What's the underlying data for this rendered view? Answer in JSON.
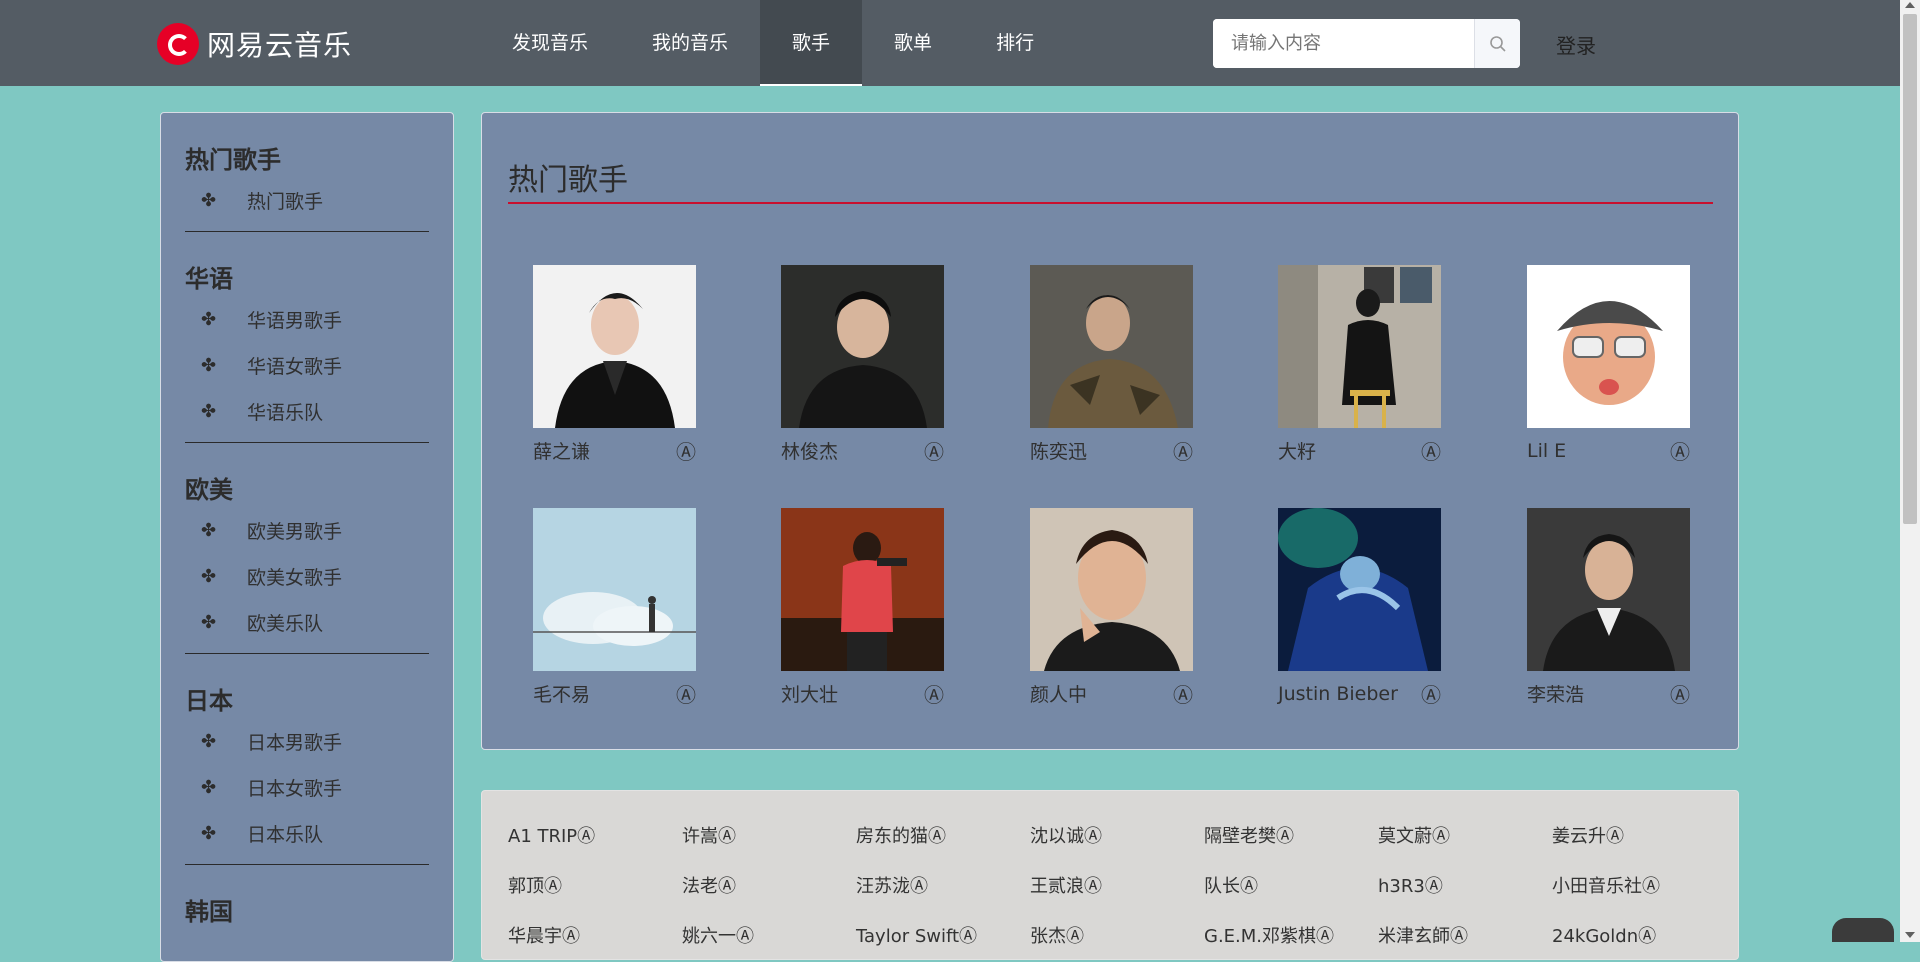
{
  "header": {
    "logo_text": "网易云音乐",
    "nav": [
      {
        "label": "发现音乐",
        "active": false
      },
      {
        "label": "我的音乐",
        "active": false
      },
      {
        "label": "歌手",
        "active": true
      },
      {
        "label": "歌单",
        "active": false
      },
      {
        "label": "排行",
        "active": false
      }
    ],
    "search_placeholder": "请输入内容",
    "search_icon": "search-icon",
    "login_label": "登录"
  },
  "sidebar": {
    "groups": [
      {
        "title": "热门歌手",
        "items": [
          "热门歌手"
        ]
      },
      {
        "title": "华语",
        "items": [
          "华语男歌手",
          "华语女歌手",
          "华语乐队"
        ]
      },
      {
        "title": "欧美",
        "items": [
          "欧美男歌手",
          "欧美女歌手",
          "欧美乐队"
        ]
      },
      {
        "title": "日本",
        "items": [
          "日本男歌手",
          "日本女歌手",
          "日本乐队"
        ]
      },
      {
        "title": "韩国",
        "items": []
      }
    ],
    "item_icon": "flower-icon"
  },
  "hot": {
    "title": "热门歌手",
    "accent": "#c8102e",
    "artists": [
      {
        "name": "薛之谦"
      },
      {
        "name": "林俊杰"
      },
      {
        "name": "陈奕迅"
      },
      {
        "name": "大籽"
      },
      {
        "name": "Lil E"
      },
      {
        "name": "毛不易"
      },
      {
        "name": "刘大壮"
      },
      {
        "name": "颜人中"
      },
      {
        "name": "Justin Bieber"
      },
      {
        "name": "李荣浩"
      }
    ],
    "artist_icon": "Ⓐ"
  },
  "all": {
    "rows": [
      [
        "A1 TRIPⒶ",
        "许嵩Ⓐ",
        "房东的猫Ⓐ",
        "沈以诚Ⓐ",
        "隔壁老樊Ⓐ",
        "莫文蔚Ⓐ",
        "姜云升Ⓐ"
      ],
      [
        "郭顶Ⓐ",
        "法老Ⓐ",
        "汪苏泷Ⓐ",
        "王贰浪Ⓐ",
        "队长Ⓐ",
        "h3R3Ⓐ",
        "小田音乐社Ⓐ"
      ],
      [
        "华晨宇Ⓐ",
        "姚六一Ⓐ",
        "Taylor SwiftⒶ",
        "张杰Ⓐ",
        "G.E.M.邓紫棋Ⓐ",
        "米津玄師Ⓐ",
        "24kGoldnⒶ"
      ]
    ]
  }
}
